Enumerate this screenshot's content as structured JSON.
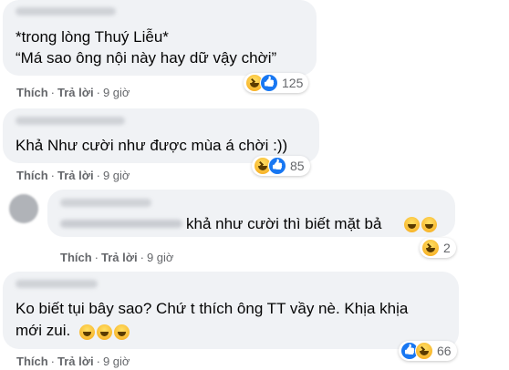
{
  "comments": [
    {
      "lines": [
        "*trong lòng Thuý Liễu*",
        "“Má sao ông nội này hay dữ vậy chời”"
      ],
      "like_label": "Thích",
      "reply_label": "Trả lời",
      "time": "9 giờ",
      "reaction_icons": [
        "haha-icon",
        "like-icon"
      ],
      "reaction_count": "125"
    },
    {
      "lines": [
        "Khả Như cười như được mùa á chời :))"
      ],
      "like_label": "Thích",
      "reply_label": "Trả lời",
      "time": "9 giờ",
      "reaction_icons": [
        "haha-icon",
        "like-icon"
      ],
      "reaction_count": "85"
    },
    {
      "lines": [
        "khả như cười thì biết mặt bả"
      ],
      "like_label": "Thích",
      "reply_label": "Trả lời",
      "time": "9 giờ",
      "reaction_icons": [
        "haha-icon"
      ],
      "reaction_count": "2"
    },
    {
      "lines": [
        "Ko biết tụi bây sao? Chứ t thích ông TT vầy nè. Khịa khịa",
        "mới zui."
      ],
      "like_label": "Thích",
      "reply_label": "Trả lời",
      "time": "9 giờ",
      "reaction_icons": [
        "like-icon",
        "haha-icon"
      ],
      "reaction_count": "66"
    }
  ],
  "colors": {
    "bubble": "#f0f2f5",
    "secondary_text": "#65676b",
    "like_blue": "#1877f2",
    "haha_yellow": "#f7b125"
  }
}
